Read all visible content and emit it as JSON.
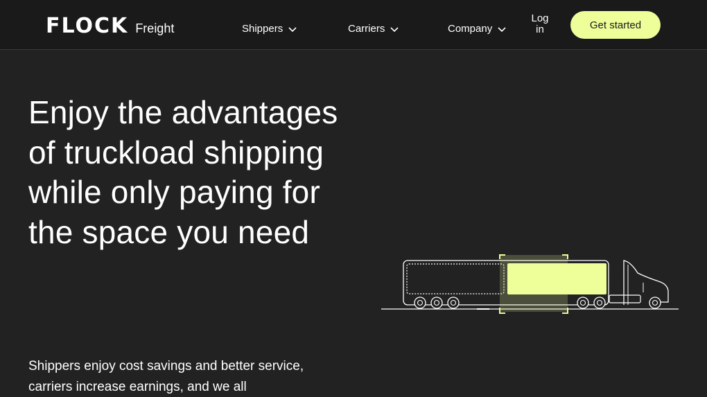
{
  "nav": {
    "logo_wordmark": "FLOCK",
    "logo_sub": "Freight",
    "items": [
      {
        "label": "Shippers"
      },
      {
        "label": "Carriers"
      },
      {
        "label": "Company"
      }
    ],
    "login_line1": "Log",
    "login_line2": "in",
    "cta_label": "Get started"
  },
  "hero": {
    "headline": "Enjoy the advantages of truckload shipping while only paying for the space you need",
    "subtext": "Shippers enjoy cost savings and better service, carriers increase earnings, and we all"
  },
  "colors": {
    "background": "#222222",
    "nav_background": "#1a1a1a",
    "accent": "#eeff99",
    "text": "#ffffff"
  },
  "icons": {
    "dropdown": "chevron-down-icon",
    "illustration": "truck-illustration"
  }
}
